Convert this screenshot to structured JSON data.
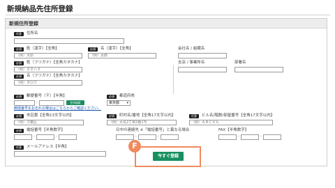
{
  "page": {
    "title": "新規納品先住所登録"
  },
  "panel": {
    "title": "新規住所登録"
  },
  "required_badge": "必須",
  "optional_badge": "任意",
  "fields": {
    "address_name": {
      "label": "住所名",
      "value": ""
    },
    "last_name": {
      "label": "姓（漢字）【全角】",
      "placeholder": "（例）大原"
    },
    "first_name": {
      "label": "名（漢字）【全角】",
      "placeholder": "（例）太郎"
    },
    "company": {
      "label": "会社名 / 組織名",
      "value": ""
    },
    "last_kana": {
      "label": "姓（フリガナ）【全角カタカナ】",
      "placeholder": "（例）オオハラ"
    },
    "first_kana": {
      "label": "名（フリガナ）【全角カタカナ】",
      "placeholder": "（例）タロウ"
    },
    "branch": {
      "label": "支店 / 事業所名",
      "value": ""
    },
    "department": {
      "label": "部署名",
      "value": ""
    },
    "postal": {
      "label": "郵便番号（〒）【半角】",
      "dash": "-",
      "lookup_button": "住所検索",
      "help_link": "郵便番号をお忘れの場合はこちらからご確認ください。"
    },
    "prefecture": {
      "label": "都道府県",
      "selected": "東京都",
      "arrow": "▾"
    },
    "city": {
      "label": "市区郡【全角13文字以内】",
      "placeholder": "（例）江東区"
    },
    "street": {
      "label": "町村名/番地【全角17文字以内】",
      "placeholder": "（例）大島2丁目2番1号"
    },
    "building": {
      "label": "ビル名/階数/部屋番号【全角17文字以内】",
      "placeholder": "（例）ＡＢＣビル"
    },
    "phone": {
      "label": "電話番号【半角数字】",
      "dash": "-"
    },
    "day_phone": {
      "label": "日中の連絡先 ※「電話番号」と異なる場合",
      "dash": "-"
    },
    "fax": {
      "label": "FAX【半角数字】",
      "dash": "-"
    },
    "email": {
      "label": "メールアドレス【半角】",
      "value": ""
    }
  },
  "submit": {
    "label": "今すぐ登録"
  },
  "marker": {
    "letter": "F"
  },
  "colors": {
    "accent_green": "#17905f",
    "highlight_orange": "#f08a5d",
    "badge_black": "#1f1f1f"
  }
}
